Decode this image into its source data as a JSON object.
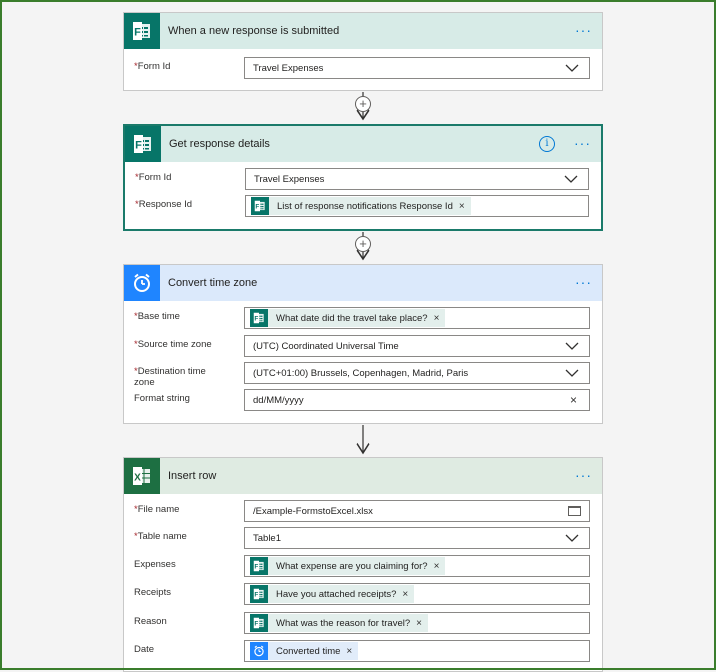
{
  "steps": {
    "trigger": {
      "title": "When a new response is submitted",
      "more": "···",
      "form_id_label": "Form Id",
      "form_id_value": "Travel Expenses"
    },
    "get_details": {
      "title": "Get response details",
      "info": "i",
      "more": "···",
      "form_id_label": "Form Id",
      "form_id_value": "Travel Expenses",
      "response_id_label": "Response Id",
      "response_id_token": "List of response notifications Response Id"
    },
    "convert_time": {
      "title": "Convert time zone",
      "more": "···",
      "base_time_label": "Base time",
      "base_time_token": "What date did the travel take place?",
      "source_tz_label": "Source time zone",
      "source_tz_value": "(UTC) Coordinated Universal Time",
      "dest_tz_label": "Destination time zone",
      "dest_tz_value": "(UTC+01:00) Brussels, Copenhagen, Madrid, Paris",
      "format_label": "Format string",
      "format_value": "dd/MM/yyyy"
    },
    "insert_row": {
      "title": "Insert row",
      "more": "···",
      "file_label": "File name",
      "file_value": "/Example-FormstoExcel.xlsx",
      "table_label": "Table name",
      "table_value": "Table1",
      "expenses_label": "Expenses",
      "expenses_token": "What expense are you claiming for?",
      "receipts_label": "Receipts",
      "receipts_token": "Have you attached receipts?",
      "reason_label": "Reason",
      "reason_token": "What was the reason for travel?",
      "date_label": "Date",
      "date_token": "Converted time"
    }
  },
  "common": {
    "required_marker": "*",
    "remove_x": "×",
    "add_step": "+"
  },
  "colors": {
    "forms_green": "#077568",
    "clock_blue": "#1f85ff",
    "excel_green": "#1d6f42",
    "link_blue": "#0078d4",
    "required_red": "#a4262c"
  },
  "icons": {
    "forms": "forms-icon",
    "clock": "clock-icon",
    "excel": "excel-icon"
  }
}
